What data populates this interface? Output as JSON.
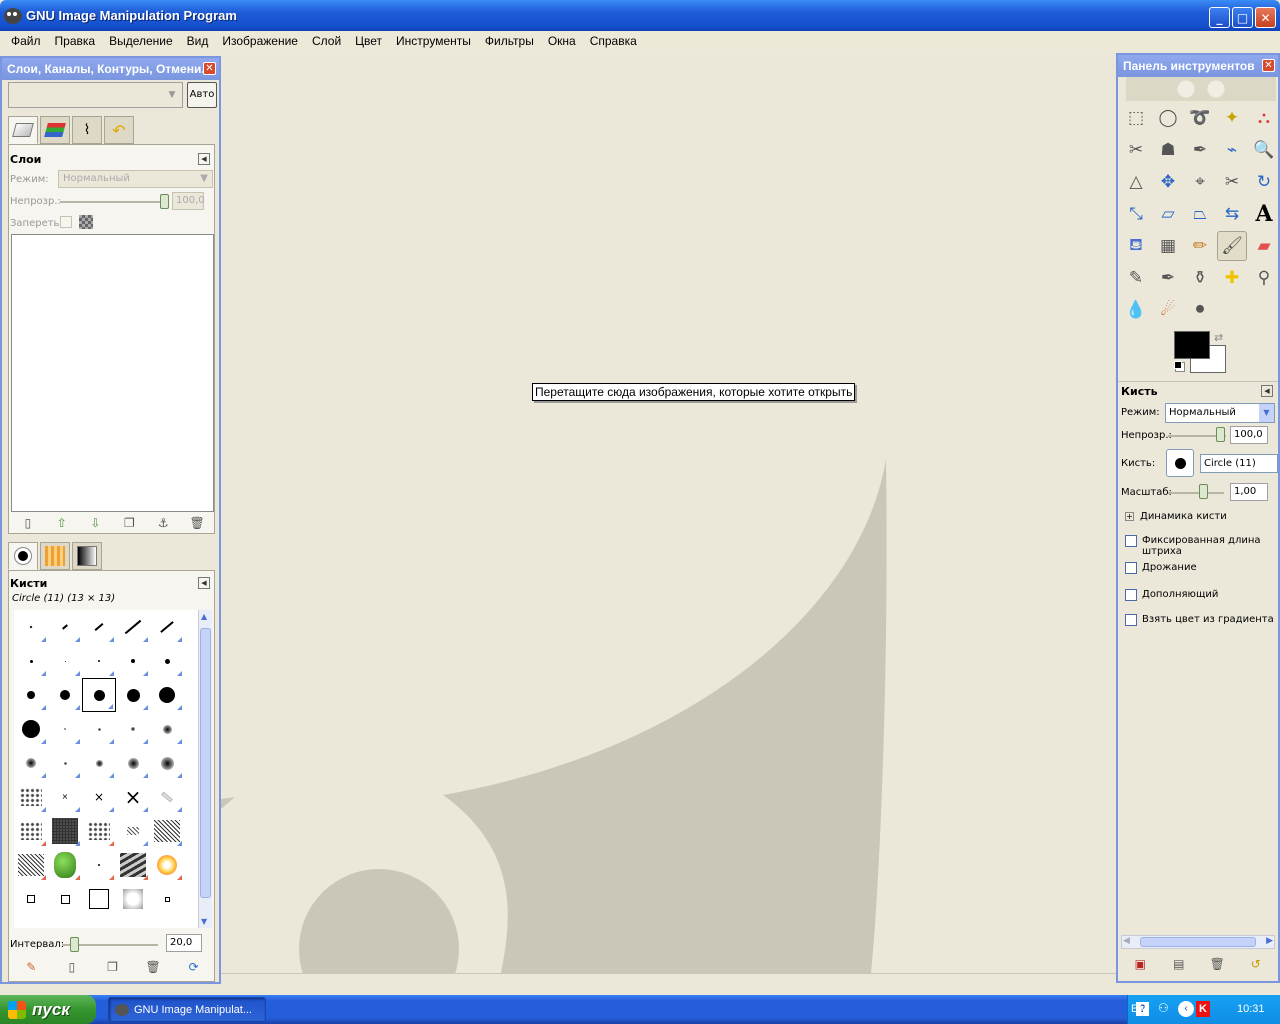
{
  "window": {
    "title": "GNU Image Manipulation Program"
  },
  "menu": [
    "Файл",
    "Правка",
    "Выделение",
    "Вид",
    "Изображение",
    "Слой",
    "Цвет",
    "Инструменты",
    "Фильтры",
    "Окна",
    "Справка"
  ],
  "left_panel": {
    "title": "Слои, Каналы, Контуры, Отмени...",
    "auto_button": "Авто",
    "tab_icons": [
      "layers-icon",
      "channels-icon",
      "paths-icon",
      "undo-icon"
    ],
    "layers": {
      "title": "Слои",
      "mode_label": "Режим:",
      "mode_value": "Нормальный",
      "opacity_label": "Непрозр.:",
      "opacity_value": "100,0",
      "lock_label": "Запереть:"
    },
    "layer_action_icons": [
      "new-layer-icon",
      "raise-layer-icon",
      "lower-layer-icon",
      "duplicate-layer-icon",
      "anchor-layer-icon",
      "delete-layer-icon"
    ],
    "brushes": {
      "title": "Кисти",
      "selected": "Circle (11) (13 × 13)",
      "interval_label": "Интервал:",
      "interval_value": "20,0"
    },
    "brush_action_icons": [
      "edit-brush-icon",
      "new-brush-icon",
      "duplicate-brush-icon",
      "delete-brush-icon",
      "refresh-brushes-icon"
    ]
  },
  "canvas": {
    "drop_hint": "Перетащите сюда изображения, которые хотите открыть"
  },
  "toolbox": {
    "title": "Панель инструментов",
    "tools": [
      "rect-select-icon",
      "ellipse-select-icon",
      "free-select-icon",
      "fuzzy-select-icon",
      "color-select-icon",
      "scissors-select-icon",
      "foreground-select-icon",
      "paths-tool-icon",
      "color-picker-icon",
      "zoom-icon",
      "measure-icon",
      "move-icon",
      "align-icon",
      "crop-icon",
      "rotate-icon",
      "scale-icon",
      "shear-icon",
      "perspective-icon",
      "flip-icon",
      "text-icon",
      "bucket-fill-icon",
      "blend-icon",
      "pencil-icon",
      "paintbrush-icon",
      "eraser-icon",
      "airbrush-icon",
      "ink-icon",
      "clone-icon",
      "heal-icon",
      "perspective-clone-icon",
      "blur-icon",
      "smudge-icon",
      "dodge-burn-icon"
    ],
    "colors": {
      "foreground": "#000000",
      "background": "#ffffff"
    },
    "options": {
      "title": "Кисть",
      "mode_label": "Режим:",
      "mode_value": "Нормальный",
      "opacity_label": "Непрозр.:",
      "opacity_value": "100,0",
      "brush_label": "Кисть:",
      "brush_value": "Circle (11)",
      "scale_label": "Масштаб:",
      "scale_value": "1,00",
      "dynamics_label": "Динамика кисти",
      "checkboxes": [
        "Фиксированная длина штриха",
        "Дрожание",
        "Дополняющий",
        "Взять цвет из градиента"
      ]
    },
    "bottom_icons": [
      "save-options-icon",
      "restore-options-icon",
      "delete-options-icon",
      "reset-options-icon"
    ]
  },
  "taskbar": {
    "start_label": "пуск",
    "task_label": "GNU Image Manipulat...",
    "lang": "EN",
    "clock": "10:31"
  }
}
